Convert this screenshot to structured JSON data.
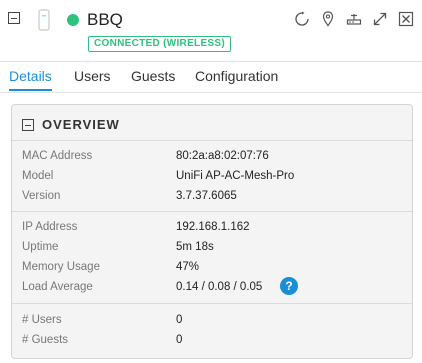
{
  "header": {
    "device_name": "BBQ",
    "connection_badge": "CONNECTED (WIRELESS)",
    "status_color": "#2ec27e",
    "tools": [
      {
        "name": "restart-icon"
      },
      {
        "name": "locate-icon"
      },
      {
        "name": "network-icon"
      },
      {
        "name": "expand-icon"
      },
      {
        "name": "close-icon"
      }
    ]
  },
  "tabs": [
    {
      "label": "Details",
      "active": true
    },
    {
      "label": "Users",
      "active": false
    },
    {
      "label": "Guests",
      "active": false
    },
    {
      "label": "Configuration",
      "active": false
    }
  ],
  "overview": {
    "title": "OVERVIEW",
    "rows": [
      {
        "label": "MAC Address",
        "value": "80:2a:a8:02:07:76"
      },
      {
        "label": "Model",
        "value": "UniFi AP-AC-Mesh-Pro"
      },
      {
        "label": "Version",
        "value": "3.7.37.6065"
      },
      {
        "label": "IP Address",
        "value": "192.168.1.162"
      },
      {
        "label": "Uptime",
        "value": "5m 18s"
      },
      {
        "label": "Memory Usage",
        "value": "47%"
      },
      {
        "label": "Load Average",
        "value": "0.14 / 0.08 / 0.05"
      },
      {
        "label": "# Users",
        "value": "0"
      },
      {
        "label": "# Guests",
        "value": "0"
      }
    ],
    "help_symbol": "?"
  },
  "colors": {
    "accent": "#1a8fd8",
    "connected": "#2ec27e"
  }
}
